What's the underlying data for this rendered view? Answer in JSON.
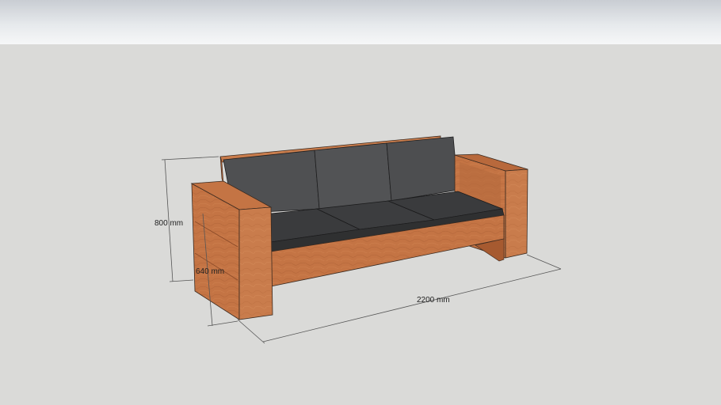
{
  "window": {
    "title": ""
  },
  "model": {
    "name": ""
  },
  "dimensions": {
    "height": "800 mm",
    "depth": "640 mm",
    "width": "2200 mm"
  },
  "colors": {
    "wood": "#c97a4a",
    "wood_dark": "#a65a30",
    "cushion": "#4b4c4e",
    "cushion_dark": "#2f3031",
    "sky": "#e6e9ec",
    "ground": "#dadad8"
  }
}
